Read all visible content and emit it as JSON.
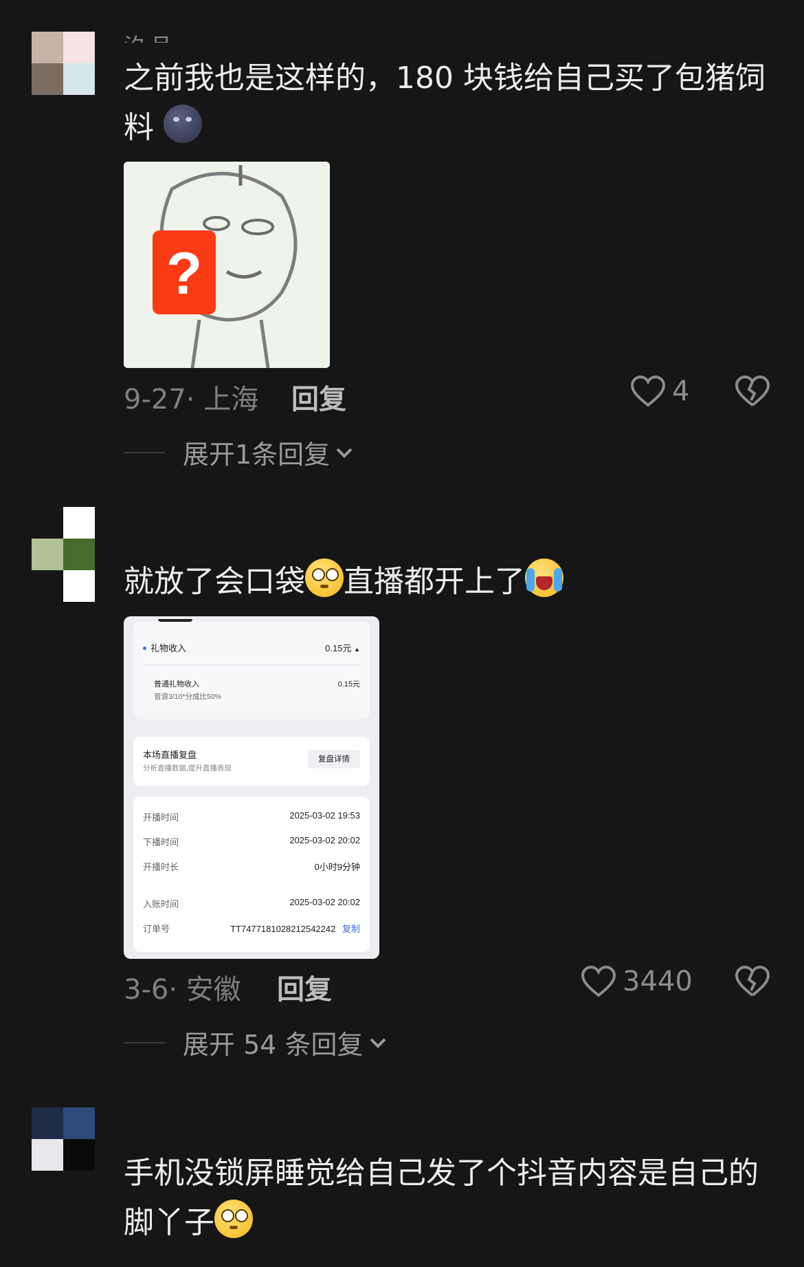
{
  "comments": [
    {
      "username": "汐·吕",
      "text": "之前我也是这样的，180 块钱给自己买了包猪饲料",
      "emoji": "new-moon-face",
      "date": "9-27",
      "location": "上海",
      "reply_label": "回复",
      "likes": "4",
      "expand_label": "展开1条回复"
    },
    {
      "username": "",
      "text_before": "就放了会口袋",
      "emoji_1": "flushed-face",
      "text_middle": "直播都开上了",
      "emoji_2": "loudly-crying-face",
      "date": "3-6",
      "location": "安徽",
      "reply_label": "回复",
      "likes": "3440",
      "expand_label": "展开 54 条回复",
      "screenshot": {
        "gift_income_label": "礼物收入",
        "gift_income_value": "0.15元",
        "normal_gift_label": "普通礼物收入",
        "normal_gift_value": "0.15元",
        "normal_gift_note": "音浪3/10*分成比50%",
        "review_title": "本场直播复盘",
        "review_sub": "分析直播数据,提升直播表现",
        "review_button": "复盘详情",
        "start_label": "开播时间",
        "start_value": "2025-03-02 19:53",
        "end_label": "下播时间",
        "end_value": "2025-03-02 20:02",
        "duration_label": "开播时长",
        "duration_value": "0小时9分钟",
        "settle_label": "入账时间",
        "settle_value": "2025-03-02 20:02",
        "order_label": "订单号",
        "order_value": "TT7477181028212542242",
        "copy_label": "复制"
      }
    },
    {
      "text": "手机没锁屏睡觉给自己发了个抖音内容是自己的脚丫子",
      "emoji": "flushed-face"
    }
  ],
  "colors": {
    "background": "#161616",
    "text": "#ededed",
    "meta": "#7f7f7f",
    "accent_blue": "#3b6fd8"
  }
}
